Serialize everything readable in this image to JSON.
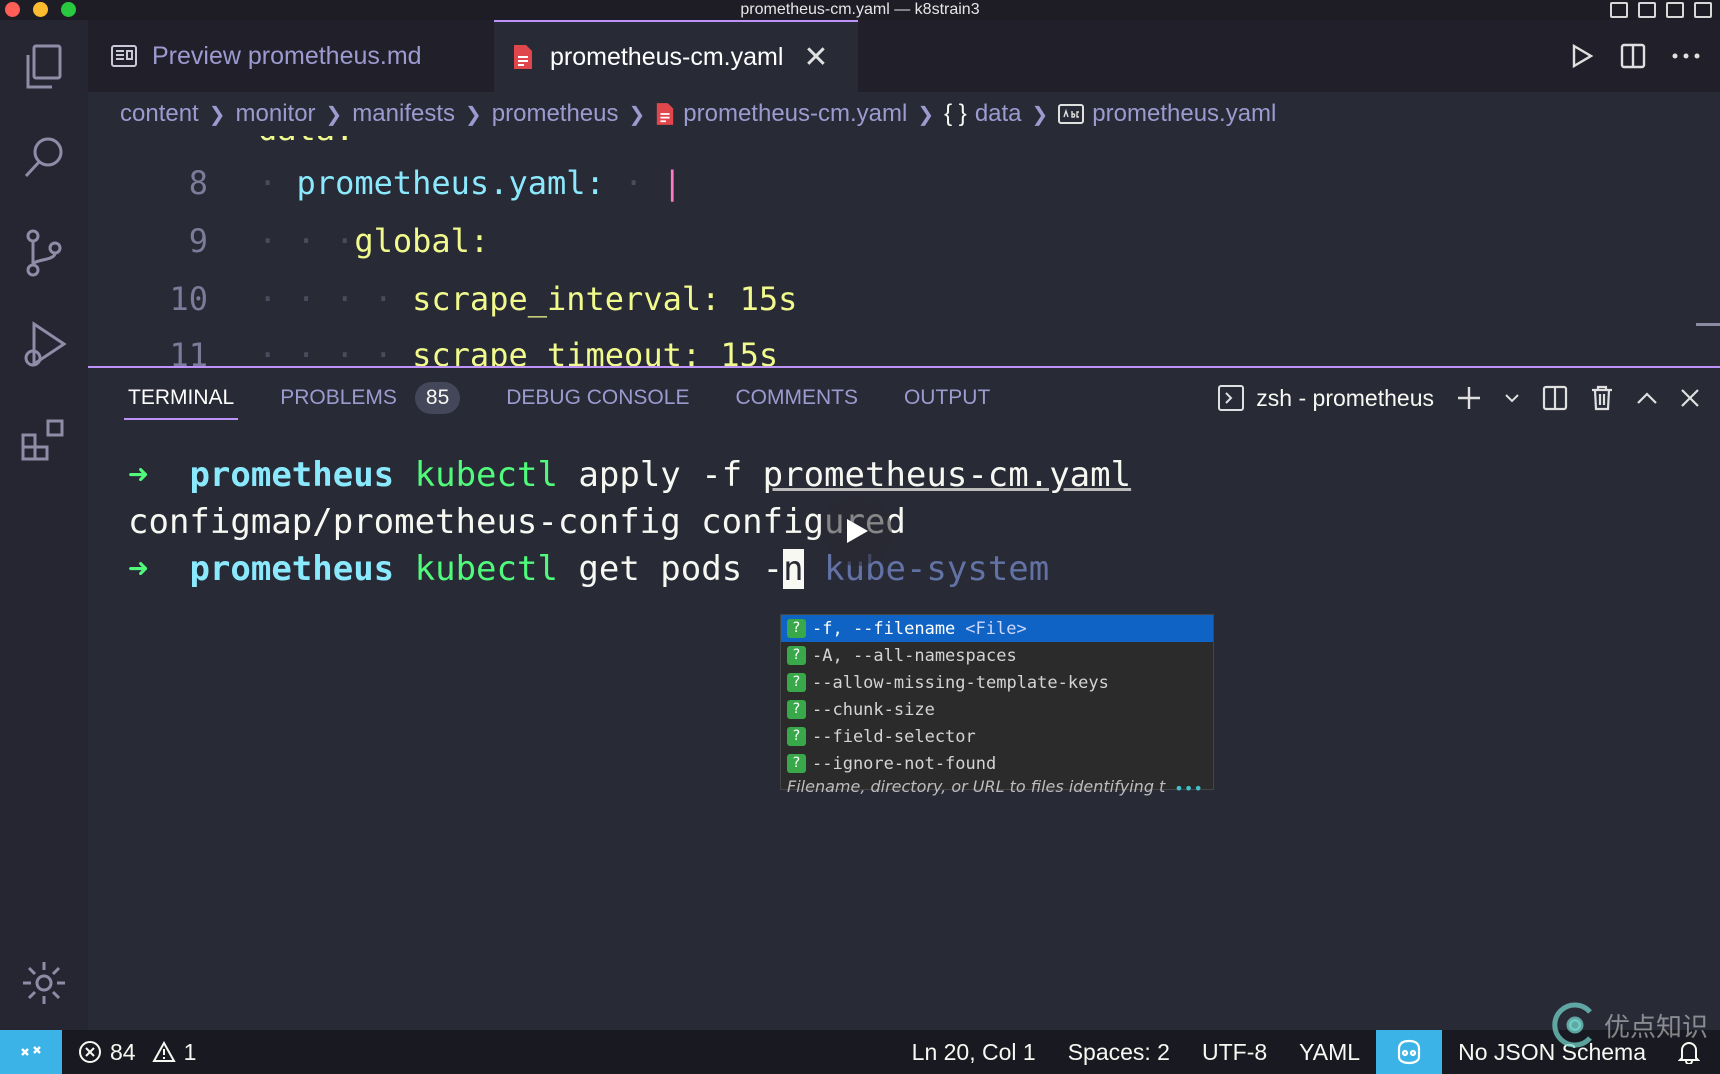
{
  "window": {
    "title": "prometheus-cm.yaml — k8strain3"
  },
  "tabs": [
    {
      "label": "Preview prometheus.md"
    },
    {
      "label": "prometheus-cm.yaml",
      "close": "✕"
    }
  ],
  "breadcrumb": [
    "content",
    "monitor",
    "manifests",
    "prometheus",
    "prometheus-cm.yaml",
    "data",
    "prometheus.yaml"
  ],
  "editor": {
    "lines": [
      {
        "num": "8",
        "key": "prometheus.yaml:",
        "value": "|"
      },
      {
        "num": "9",
        "key": "global:",
        "value": ""
      },
      {
        "num": "10",
        "key": "scrape_interval:",
        "value": "15s"
      },
      {
        "num": "11",
        "key": "scrape_timeout:",
        "value": "15s"
      }
    ]
  },
  "panel": {
    "tabs": [
      "TERMINAL",
      "PROBLEMS",
      "DEBUG CONSOLE",
      "COMMENTS",
      "OUTPUT"
    ],
    "problems_count": "85",
    "terminal_name": "zsh - prometheus"
  },
  "terminal": {
    "prompt_arrow": "➜",
    "line1": {
      "dir": "prometheus",
      "cmd": "kubectl",
      "args": "apply -f ",
      "file": "prometheus-cm.yaml"
    },
    "line2": "configmap/prometheus-config configured",
    "line3": {
      "dir": "prometheus",
      "cmd": "kubectl",
      "args": "get pods -",
      "cursor": "n",
      "ghost": " kube-system"
    }
  },
  "suggest": {
    "items": [
      {
        "label": "-f, --filename",
        "type": "<File>"
      },
      {
        "label": "-A, --all-namespaces",
        "type": ""
      },
      {
        "label": "--allow-missing-template-keys",
        "type": ""
      },
      {
        "label": "--chunk-size",
        "type": ""
      },
      {
        "label": "--field-selector",
        "type": ""
      },
      {
        "label": "--ignore-not-found",
        "type": ""
      }
    ],
    "description": "Filename, directory, or URL to files identifying t",
    "more": "•••"
  },
  "statusbar": {
    "errors": "84",
    "warnings": "1",
    "position": "Ln 20, Col 1",
    "spaces": "Spaces: 2",
    "encoding": "UTF-8",
    "language": "YAML",
    "schema": "No JSON Schema"
  },
  "watermark": "优点知识"
}
